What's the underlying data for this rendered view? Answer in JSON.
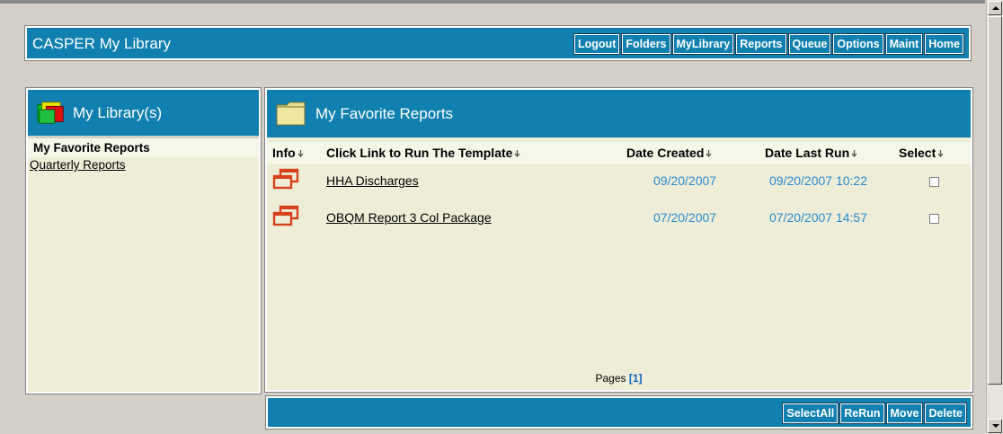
{
  "app": {
    "title": "CASPER My Library"
  },
  "nav": [
    {
      "label": "Logout"
    },
    {
      "label": "Folders"
    },
    {
      "label": "MyLibrary"
    },
    {
      "label": "Reports"
    },
    {
      "label": "Queue"
    },
    {
      "label": "Options"
    },
    {
      "label": "Maint"
    },
    {
      "label": "Home"
    }
  ],
  "library": {
    "title": "My Library(s)",
    "items": [
      {
        "label": "My Favorite Reports",
        "selected": true
      },
      {
        "label": "Quarterly Reports",
        "selected": false
      }
    ]
  },
  "favorites": {
    "title": "My Favorite Reports",
    "columns": {
      "info": "Info",
      "template": "Click Link to Run The Template",
      "created": "Date Created",
      "last_run": "Date Last Run",
      "select": "Select"
    },
    "rows": [
      {
        "name": "HHA Discharges",
        "created": "09/20/2007",
        "last_run": "09/20/2007 10:22"
      },
      {
        "name": "OBQM Report 3 Col Package",
        "created": "07/20/2007",
        "last_run": "07/20/2007 14:57"
      }
    ],
    "pages_label": "Pages",
    "page_current": "[1]"
  },
  "actions": [
    {
      "label": "SelectAll"
    },
    {
      "label": "ReRun"
    },
    {
      "label": "Move"
    },
    {
      "label": "Delete"
    }
  ],
  "colors": {
    "header_blue": "#1080b0",
    "date_blue": "#2a8ad0",
    "panel_bg": "#eeeed8",
    "icon_red": "#d8401c"
  },
  "icons": [
    "multi-window-icon",
    "folder-icon",
    "library-folders-icon",
    "sort-arrow-icon"
  ]
}
